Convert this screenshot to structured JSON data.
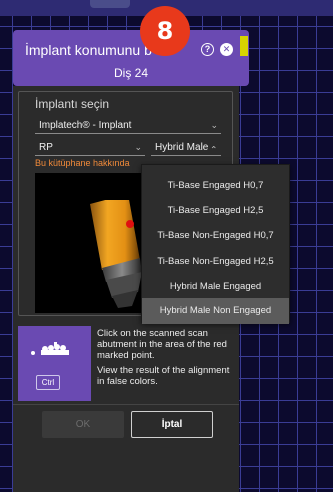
{
  "dialog": {
    "title": "İmplant konumunu b",
    "subtitle": "Diş 24",
    "help_icon": "help-icon",
    "close_icon": "close-icon",
    "step_badge": "8"
  },
  "implant_select": {
    "label": "İmplantı seçin",
    "library": "Implatech® - Implant",
    "type": "RP",
    "variant": "Hybrid Male",
    "library_info": "Bu kütüphane hakkında"
  },
  "dropdown": {
    "options": [
      "Ti-Base Engaged H0,7",
      "Ti-Base Engaged H2,5",
      "Ti-Base Non-Engaged H0,7",
      "Ti-Base Non-Engaged H2,5",
      "Hybrid Male Engaged",
      "Hybrid Male Non Engaged"
    ],
    "selected": "Hybrid Male Non Engaged"
  },
  "hint": {
    "line1": "Click on the scanned scan abutment in the area of the red marked point.",
    "line2": "View the result of the alignment in false colors.",
    "ctrl_key": "Ctrl"
  },
  "footer": {
    "ok_label": "OK",
    "cancel_label": "İptal"
  },
  "colors": {
    "accent_purple": "#6a4ab2",
    "badge_red": "#e8391b",
    "warning_orange": "#f08a3a",
    "abutment_gold": "#f0a020"
  }
}
